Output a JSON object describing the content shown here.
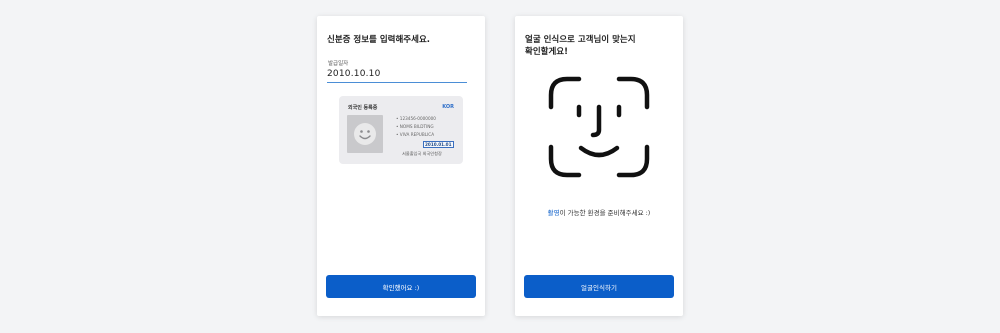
{
  "colors": {
    "accent": "#0b5ec9",
    "card_bg": "#ececef",
    "background": "#f3f4f6"
  },
  "id_screen": {
    "title": "신분증 정보를 입력해주세요.",
    "field_label": "발급일자",
    "field_value": "2010.10.10",
    "card": {
      "title": "외국인 등록증",
      "code": "KOR",
      "lines": [
        "• 123456-0000000",
        "• NOMS BILDTING",
        "• VIVA REPUBLICA"
      ],
      "date": "2010.01.01",
      "issuer": "서울출입국 외국인청장",
      "photo_icon": "smiley-face-icon"
    },
    "button_label": "확인했어요 :)"
  },
  "face_screen": {
    "title_line1": "얼굴 인식으로 고객님이 맞는지",
    "title_line2": "확인할게요!",
    "face_icon": "face-id-icon",
    "hint_accent": "촬영",
    "hint_rest": "이 가능한 환경을 준비해주세요 :)",
    "button_label": "얼굴인식하기"
  }
}
